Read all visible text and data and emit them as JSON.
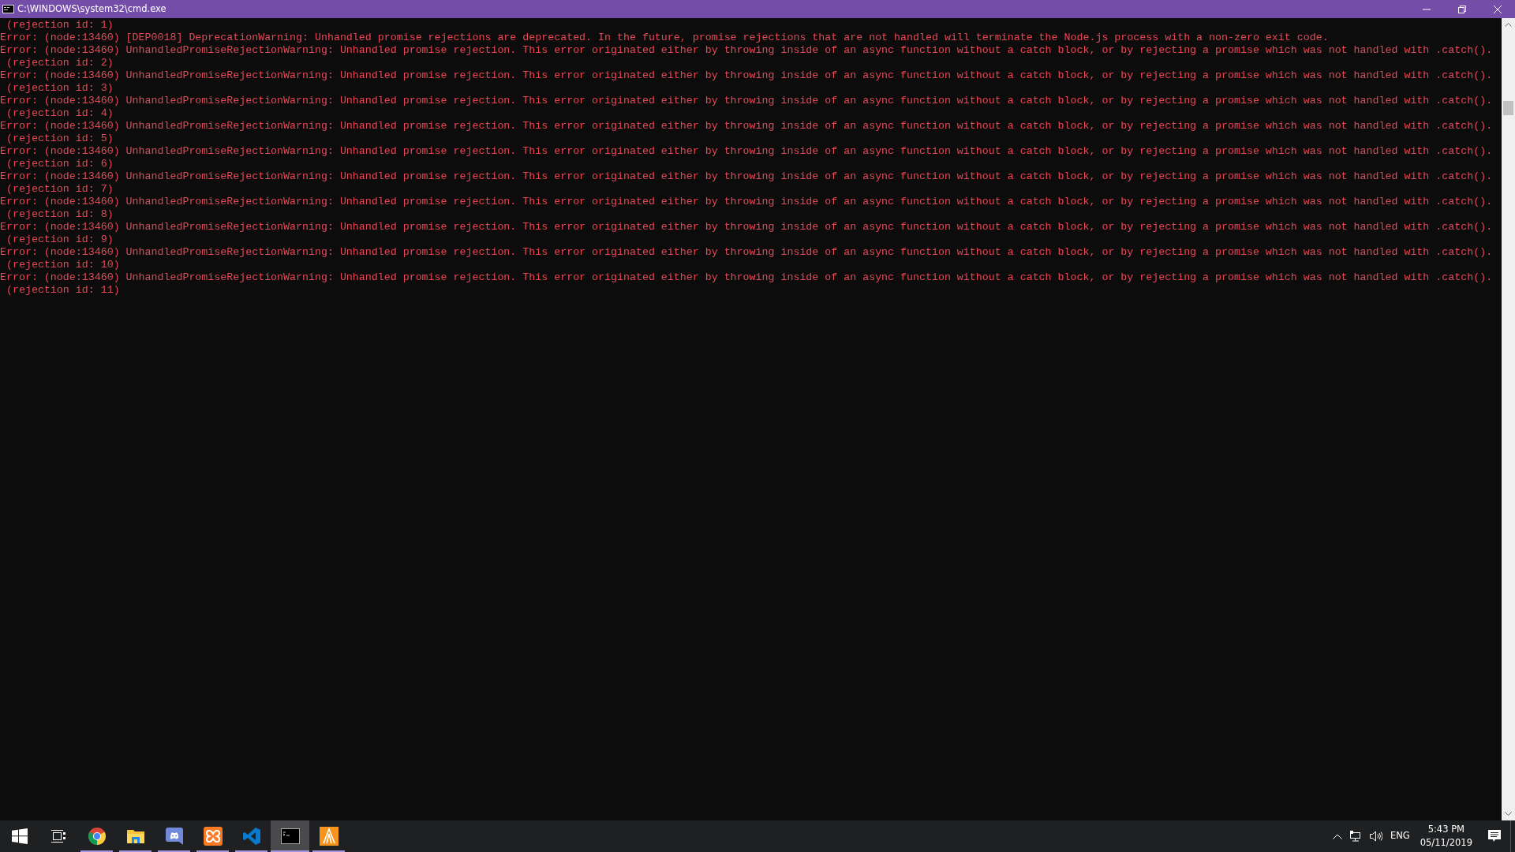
{
  "window": {
    "title": "C:\\WINDOWS\\system32\\cmd.exe"
  },
  "console_lines": [
    " (rejection id: 1)",
    "Error: (node:13460) [DEP0018] DeprecationWarning: Unhandled promise rejections are deprecated. In the future, promise rejections that are not handled will terminate the Node.js process with a non-zero exit code.",
    "Error: (node:13460) UnhandledPromiseRejectionWarning: Unhandled promise rejection. This error originated either by throwing inside of an async function without a catch block, or by rejecting a promise which was not handled with .catch().",
    " (rejection id: 2)",
    "Error: (node:13460) UnhandledPromiseRejectionWarning: Unhandled promise rejection. This error originated either by throwing inside of an async function without a catch block, or by rejecting a promise which was not handled with .catch().",
    " (rejection id: 3)",
    "Error: (node:13460) UnhandledPromiseRejectionWarning: Unhandled promise rejection. This error originated either by throwing inside of an async function without a catch block, or by rejecting a promise which was not handled with .catch().",
    " (rejection id: 4)",
    "Error: (node:13460) UnhandledPromiseRejectionWarning: Unhandled promise rejection. This error originated either by throwing inside of an async function without a catch block, or by rejecting a promise which was not handled with .catch().",
    " (rejection id: 5)",
    "Error: (node:13460) UnhandledPromiseRejectionWarning: Unhandled promise rejection. This error originated either by throwing inside of an async function without a catch block, or by rejecting a promise which was not handled with .catch().",
    " (rejection id: 6)",
    "Error: (node:13460) UnhandledPromiseRejectionWarning: Unhandled promise rejection. This error originated either by throwing inside of an async function without a catch block, or by rejecting a promise which was not handled with .catch().",
    " (rejection id: 7)",
    "Error: (node:13460) UnhandledPromiseRejectionWarning: Unhandled promise rejection. This error originated either by throwing inside of an async function without a catch block, or by rejecting a promise which was not handled with .catch().",
    " (rejection id: 8)",
    "Error: (node:13460) UnhandledPromiseRejectionWarning: Unhandled promise rejection. This error originated either by throwing inside of an async function without a catch block, or by rejecting a promise which was not handled with .catch().",
    " (rejection id: 9)",
    "Error: (node:13460) UnhandledPromiseRejectionWarning: Unhandled promise rejection. This error originated either by throwing inside of an async function without a catch block, or by rejecting a promise which was not handled with .catch().",
    " (rejection id: 10)",
    "Error: (node:13460) UnhandledPromiseRejectionWarning: Unhandled promise rejection. This error originated either by throwing inside of an async function without a catch block, or by rejecting a promise which was not handled with .catch().",
    " (rejection id: 11)"
  ],
  "taskbar": {
    "items": [
      {
        "kind": "start",
        "running": false,
        "selected": false
      },
      {
        "kind": "taskview",
        "running": false,
        "selected": false
      },
      {
        "kind": "chrome",
        "running": true,
        "selected": false
      },
      {
        "kind": "explorer",
        "running": true,
        "selected": false
      },
      {
        "kind": "discord",
        "running": true,
        "selected": false
      },
      {
        "kind": "xampp",
        "running": true,
        "selected": false
      },
      {
        "kind": "vscode",
        "running": true,
        "selected": false
      },
      {
        "kind": "terminal",
        "running": true,
        "selected": true
      },
      {
        "kind": "filezilla",
        "running": true,
        "selected": false
      }
    ],
    "tray": {
      "language": "ENG",
      "time": "5:43 PM",
      "date": "05/11/2019"
    }
  }
}
